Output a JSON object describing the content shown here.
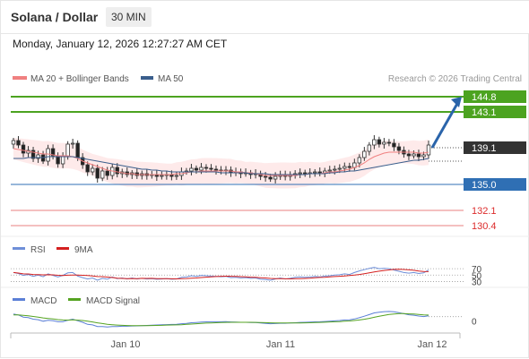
{
  "header": {
    "title": "Solana / Dollar",
    "interval": "30 MIN"
  },
  "datetime": "Monday, January 12, 2026 12:27:27 AM CET",
  "legend": {
    "bollinger": "MA 20 + Bollinger Bands",
    "ma50": "MA 50",
    "copyright": "Research © 2026 Trading Central"
  },
  "colors": {
    "resistance": "#4ca320",
    "support": "#2f6fb4",
    "target_low": "#dc2b2b",
    "last_price_tag": "#333333",
    "arrow": "#2a64aa",
    "bollinger": "#f08080",
    "bollinger_fill": "#fde3e3",
    "ma50": "#3a5e8c",
    "rsi": "#6f8fd8",
    "rsi_ma": "#d42020",
    "macd": "#5b7fd6",
    "macd_signal": "#55a321",
    "candle_up": "#ffffff",
    "candle_down": "#222222"
  },
  "indicators": {
    "rsi": {
      "label": "RSI",
      "ma_label": "9MA",
      "levels": [
        "70",
        "50",
        "30"
      ]
    },
    "macd": {
      "label": "MACD",
      "signal_label": "MACD Signal",
      "zero_label": "0"
    }
  },
  "chart_data": {
    "type": "candlestick",
    "x_axis": {
      "ticks": [
        "Jan 10",
        "Jan 11",
        "Jan 12"
      ]
    },
    "y_range": [
      129.0,
      146.0
    ],
    "levels": [
      {
        "value": 144.8,
        "label": "144.8",
        "kind": "resistance"
      },
      {
        "value": 143.1,
        "label": "143.1",
        "kind": "resistance"
      },
      {
        "value": 139.1,
        "label": "139.1",
        "kind": "last_price"
      },
      {
        "value": 135.0,
        "label": "135.0",
        "kind": "support"
      },
      {
        "value": 132.1,
        "label": "132.1",
        "kind": "target_low"
      },
      {
        "value": 130.4,
        "label": "130.4",
        "kind": "target_low"
      }
    ],
    "arrow": {
      "from": 139.1,
      "to": 144.8
    },
    "price_close": [
      139.9,
      139.4,
      138.5,
      138.8,
      137.9,
      138.3,
      137.6,
      139.0,
      138.2,
      137.3,
      138.1,
      139.5,
      139.6,
      138.0,
      137.2,
      136.4,
      136.8,
      135.7,
      136.5,
      136.0,
      136.9,
      136.2,
      136.4,
      136.1,
      136.3,
      136.0,
      136.2,
      136.0,
      136.1,
      135.9,
      136.0,
      136.1,
      135.9,
      136.0,
      136.4,
      136.5,
      136.8,
      136.6,
      136.9,
      136.8,
      136.7,
      136.6,
      136.5,
      136.6,
      136.3,
      136.4,
      136.2,
      136.3,
      136.1,
      136.2,
      135.9,
      135.8,
      135.6,
      135.9,
      136.1,
      135.9,
      136.0,
      136.2,
      136.3,
      136.2,
      136.3,
      136.4,
      136.3,
      136.5,
      136.6,
      136.7,
      136.8,
      137.0,
      136.9,
      137.4,
      138.0,
      138.7,
      139.4,
      140.0,
      139.5,
      139.7,
      139.6,
      139.2,
      138.8,
      138.4,
      138.2,
      138.4,
      138.1,
      138.3,
      139.4
    ],
    "ma20_approx": [
      139.0,
      138.9,
      138.8,
      138.7,
      138.6,
      138.5,
      138.4,
      138.4,
      138.3,
      138.2,
      138.2,
      138.2,
      138.1,
      137.9,
      137.6,
      137.4,
      137.2,
      137.0,
      136.8,
      136.6,
      136.5,
      136.4,
      136.3,
      136.2,
      136.2,
      136.1,
      136.1,
      136.1,
      136.1,
      136.1,
      136.1,
      136.1,
      136.1,
      136.2,
      136.2,
      136.3,
      136.4,
      136.4,
      136.5,
      136.5,
      136.5,
      136.5,
      136.5,
      136.5,
      136.5,
      136.4,
      136.4,
      136.3,
      136.3,
      136.2,
      136.1,
      136.0,
      136.0,
      136.0,
      136.0,
      136.0,
      136.0,
      136.0,
      136.1,
      136.1,
      136.2,
      136.2,
      136.2,
      136.3,
      136.4,
      136.4,
      136.5,
      136.6,
      136.7,
      136.9,
      137.1,
      137.4,
      137.8,
      138.1,
      138.3,
      138.5,
      138.6,
      138.6,
      138.6,
      138.6,
      138.6,
      138.6,
      138.5,
      138.5,
      138.6
    ],
    "ma50_approx": [
      137.9,
      137.9,
      137.9,
      138.0,
      138.0,
      138.0,
      138.0,
      138.1,
      138.1,
      138.1,
      138.1,
      138.1,
      138.1,
      138.0,
      137.9,
      137.8,
      137.7,
      137.6,
      137.5,
      137.4,
      137.3,
      137.2,
      137.1,
      137.0,
      136.9,
      136.8,
      136.7,
      136.7,
      136.6,
      136.6,
      136.5,
      136.5,
      136.4,
      136.4,
      136.4,
      136.4,
      136.4,
      136.4,
      136.4,
      136.4,
      136.4,
      136.4,
      136.3,
      136.3,
      136.3,
      136.3,
      136.3,
      136.3,
      136.2,
      136.2,
      136.2,
      136.2,
      136.1,
      136.1,
      136.1,
      136.1,
      136.1,
      136.1,
      136.1,
      136.1,
      136.2,
      136.2,
      136.2,
      136.2,
      136.3,
      136.3,
      136.4,
      136.4,
      136.5,
      136.5,
      136.6,
      136.7,
      136.8,
      136.9,
      137.0,
      137.1,
      137.2,
      137.3,
      137.4,
      137.5,
      137.6,
      137.7,
      137.7,
      137.8,
      137.9
    ],
    "rsi": [
      58,
      55,
      49,
      52,
      46,
      50,
      45,
      54,
      49,
      44,
      49,
      57,
      58,
      47,
      42,
      38,
      41,
      34,
      40,
      37,
      44,
      39,
      41,
      38,
      41,
      38,
      40,
      38,
      39,
      37,
      38,
      39,
      37,
      38,
      43,
      44,
      48,
      46,
      49,
      48,
      47,
      46,
      45,
      46,
      42,
      43,
      41,
      42,
      40,
      41,
      37,
      36,
      34,
      38,
      41,
      38,
      40,
      43,
      44,
      43,
      44,
      46,
      44,
      47,
      48,
      50,
      51,
      54,
      52,
      58,
      63,
      67,
      71,
      74,
      70,
      71,
      70,
      66,
      62,
      58,
      56,
      58,
      55,
      57,
      66
    ],
    "macd": [
      0.6,
      0.5,
      0.3,
      0.25,
      0.1,
      0.05,
      -0.1,
      0.0,
      -0.05,
      -0.15,
      -0.15,
      0.0,
      0.1,
      -0.05,
      -0.2,
      -0.4,
      -0.45,
      -0.6,
      -0.6,
      -0.65,
      -0.6,
      -0.6,
      -0.58,
      -0.58,
      -0.55,
      -0.54,
      -0.52,
      -0.5,
      -0.48,
      -0.46,
      -0.44,
      -0.42,
      -0.41,
      -0.4,
      -0.34,
      -0.3,
      -0.24,
      -0.22,
      -0.18,
      -0.16,
      -0.15,
      -0.15,
      -0.15,
      -0.14,
      -0.17,
      -0.18,
      -0.2,
      -0.2,
      -0.22,
      -0.22,
      -0.26,
      -0.3,
      -0.34,
      -0.32,
      -0.29,
      -0.29,
      -0.27,
      -0.24,
      -0.21,
      -0.2,
      -0.18,
      -0.16,
      -0.15,
      -0.12,
      -0.09,
      -0.06,
      -0.03,
      0.02,
      0.04,
      0.12,
      0.24,
      0.38,
      0.54,
      0.7,
      0.76,
      0.82,
      0.84,
      0.8,
      0.72,
      0.62,
      0.52,
      0.48,
      0.4,
      0.35,
      0.42
    ],
    "macd_signal": [
      0.5,
      0.5,
      0.46,
      0.42,
      0.36,
      0.3,
      0.22,
      0.17,
      0.12,
      0.06,
      0.02,
      0.01,
      0.03,
      0.01,
      -0.03,
      -0.1,
      -0.17,
      -0.25,
      -0.32,
      -0.39,
      -0.43,
      -0.47,
      -0.49,
      -0.51,
      -0.52,
      -0.52,
      -0.52,
      -0.52,
      -0.51,
      -0.5,
      -0.49,
      -0.47,
      -0.46,
      -0.45,
      -0.43,
      -0.4,
      -0.37,
      -0.34,
      -0.31,
      -0.28,
      -0.26,
      -0.24,
      -0.22,
      -0.21,
      -0.2,
      -0.2,
      -0.2,
      -0.2,
      -0.2,
      -0.21,
      -0.22,
      -0.23,
      -0.25,
      -0.26,
      -0.27,
      -0.27,
      -0.27,
      -0.27,
      -0.26,
      -0.25,
      -0.24,
      -0.22,
      -0.21,
      -0.19,
      -0.17,
      -0.15,
      -0.13,
      -0.1,
      -0.07,
      -0.03,
      0.02,
      0.09,
      0.18,
      0.28,
      0.38,
      0.47,
      0.55,
      0.6,
      0.63,
      0.63,
      0.61,
      0.59,
      0.55,
      0.51,
      0.49
    ]
  }
}
